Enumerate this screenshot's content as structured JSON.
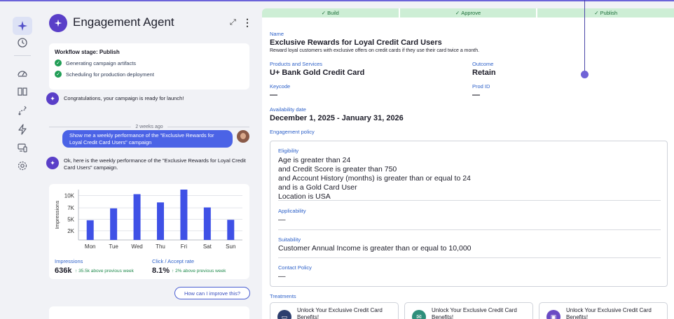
{
  "rail": {
    "items": [
      {
        "name": "agent",
        "icon": "sparkle-icon"
      },
      {
        "name": "history",
        "icon": "clock-icon"
      },
      {
        "name": "analytics",
        "icon": "gauge-icon"
      },
      {
        "name": "library",
        "icon": "book-icon"
      },
      {
        "name": "journeys",
        "icon": "route-icon"
      },
      {
        "name": "automation",
        "icon": "bolt-icon"
      },
      {
        "name": "channels",
        "icon": "devices-icon"
      },
      {
        "name": "settings",
        "icon": "gear-icon"
      }
    ]
  },
  "chat": {
    "title": "Engagement Agent",
    "workflow": {
      "stage_label": "Workflow stage: Publish",
      "items": [
        "Generating campaign artifacts",
        "Scheduling for production deployment"
      ]
    },
    "congrats": "Congratulations, your campaign is ready for launch!",
    "divider": "2 weeks ago",
    "user_message": "Show me a weekly performance of the \"Exclusive Rewards for Loyal Credit Card Users\" campaign",
    "bot_reply": "Ok, here is the weekly performance of the \"Exclusive Rewards for Loyal Credit Card Users\" campaign.",
    "improve_button": "How can I improve this?"
  },
  "chart_data": {
    "type": "bar",
    "categories": [
      "Mon",
      "Tue",
      "Wed",
      "Thu",
      "Fri",
      "Sat",
      "Sun"
    ],
    "values": [
      4300,
      6900,
      10000,
      8200,
      11000,
      7100,
      4400
    ],
    "ylabel": "Impressions",
    "yticks": [
      "2K",
      "5K",
      "7K",
      "10K"
    ],
    "ytick_values": [
      2000,
      4500,
      7000,
      9700
    ],
    "ylim": [
      0,
      11000
    ],
    "bar_color": "#3f51e6",
    "metrics": [
      {
        "label": "Impressions",
        "value": "636k",
        "delta": "35.5k above previous week"
      },
      {
        "label": "Click / Accept rate",
        "value": "8.1%",
        "delta": "2% above previous week"
      }
    ]
  },
  "steps": [
    "Build",
    "Approve",
    "Publish"
  ],
  "detail": {
    "name_label": "Name",
    "name": "Exclusive Rewards for Loyal Credit Card Users",
    "description": "Reward loyal customers with exclusive offers on credit cards if they use their card twice a month.",
    "products_label": "Products and Services",
    "products": "U+ Bank Gold Credit Card",
    "outcome_label": "Outcome",
    "outcome": "Retain",
    "keycode_label": "Keycode",
    "keycode": "—",
    "prodid_label": "Prod ID",
    "prodid": "—",
    "availability_label": "Availability date",
    "availability": "December 1, 2025 - January 31, 2026",
    "policy_label": "Engagement policy",
    "eligibility_label": "Eligibility",
    "eligibility": [
      "Age is greater than 24",
      "and Credit Score is greater than 750",
      "and Account History (months) is greater than or equal to 24",
      "and is a Gold Card User",
      "Location is USA"
    ],
    "applicability_label": "Applicability",
    "applicability": "—",
    "suitability_label": "Suitability",
    "suitability": "Customer Annual Income is greater than or equal to 10,000",
    "contact_label": "Contact Policy",
    "contact": "—",
    "treatments_label": "Treatments",
    "treatments": [
      {
        "title": "Unlock Your Exclusive Credit Card Benefits!",
        "icon": "screen-icon",
        "color": "#2e3f6e"
      },
      {
        "title": "Unlock Your Exclusive Credit Card Benefits!",
        "icon": "mail-icon",
        "color": "#2f8f7b"
      },
      {
        "title": "Unlock Your Exclusive Credit Card Benefits!",
        "icon": "devices-icon",
        "color": "#6a4bc4"
      }
    ]
  }
}
